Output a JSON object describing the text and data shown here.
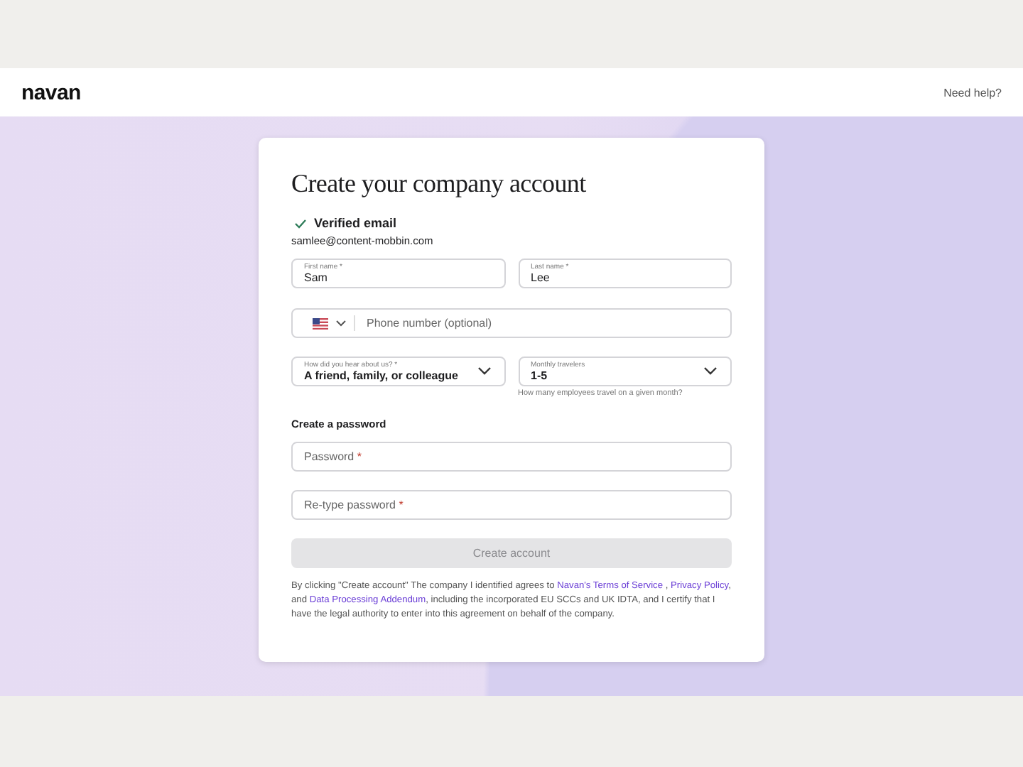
{
  "header": {
    "logo": "navan",
    "help_link": "Need help?"
  },
  "form": {
    "title": "Create your company account",
    "verified": {
      "label": "Verified email",
      "email": "samlee@content-mobbin.com"
    },
    "first_name": {
      "label": "First name *",
      "value": "Sam"
    },
    "last_name": {
      "label": "Last name *",
      "value": "Lee"
    },
    "phone": {
      "placeholder": "Phone number (optional)"
    },
    "referral": {
      "label": "How did you hear about us? *",
      "value": "A friend, family, or colleague"
    },
    "travelers": {
      "label": "Monthly travelers",
      "value": "1-5",
      "hint": "How many employees travel on a given month?"
    },
    "password_heading": "Create a password",
    "password": {
      "placeholder": "Password",
      "required": "*"
    },
    "retype": {
      "placeholder": "Re-type password",
      "required": "*"
    },
    "submit": {
      "label": "Create account",
      "disabled": true
    },
    "legal": [
      {
        "kind": "text",
        "text": "By clicking \"Create account\" The company I identified agrees to "
      },
      {
        "kind": "link",
        "text": "Navan's Terms of Service"
      },
      {
        "kind": "text",
        "text": " , "
      },
      {
        "kind": "link",
        "text": "Privacy Policy"
      },
      {
        "kind": "text",
        "text": ", and "
      },
      {
        "kind": "link",
        "text": "Data Processing Addendum"
      },
      {
        "kind": "text",
        "text": ", including the incorporated EU SCCs and UK IDTA, and I certify that I have the legal authority to enter into this agreement on behalf of the company."
      }
    ]
  }
}
